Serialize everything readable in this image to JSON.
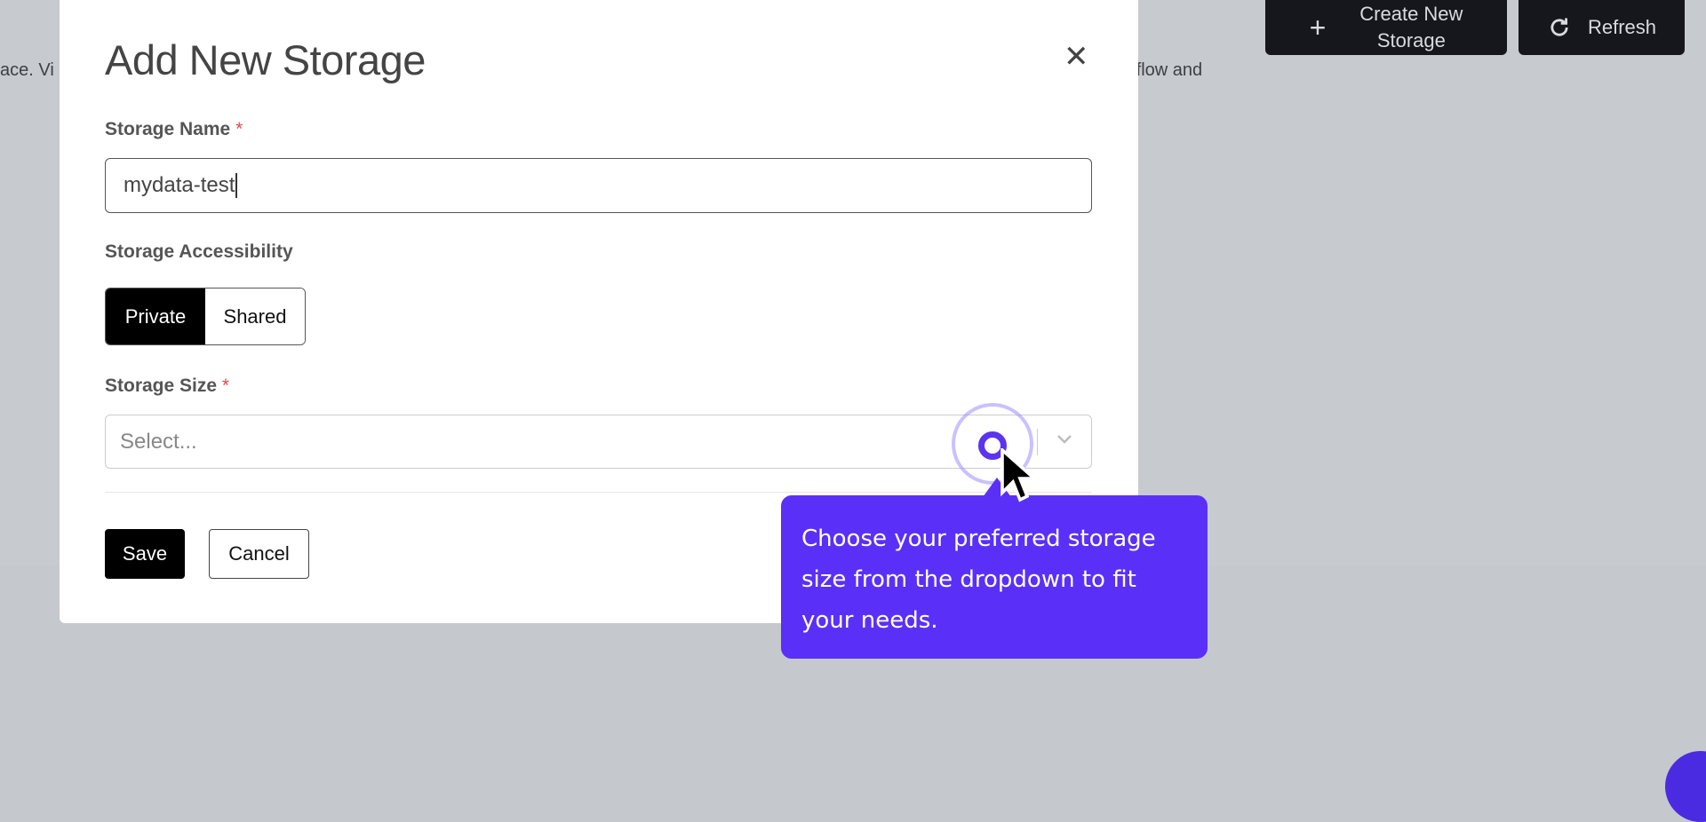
{
  "background": {
    "text_left": "ace. Vi",
    "text_right": "rkflow and"
  },
  "header": {
    "create_label_line1": "Create New",
    "create_label_line2": "Storage",
    "refresh_label": "Refresh"
  },
  "modal": {
    "title": "Add New Storage",
    "storage_name_label": "Storage Name",
    "required_mark": "*",
    "storage_name_value": "mydata-test",
    "accessibility_label": "Storage Accessibility",
    "accessibility_options": [
      "Private",
      "Shared"
    ],
    "accessibility_selected": "Private",
    "storage_size_label": "Storage Size",
    "storage_size_placeholder": "Select...",
    "save_label": "Save",
    "cancel_label": "Cancel"
  },
  "tooltip": {
    "text": "Choose your preferred storage size from the dropdown to fit your needs."
  },
  "colors": {
    "accent": "#5a30f8",
    "dark_button": "#15171c",
    "required": "#e5484d"
  }
}
